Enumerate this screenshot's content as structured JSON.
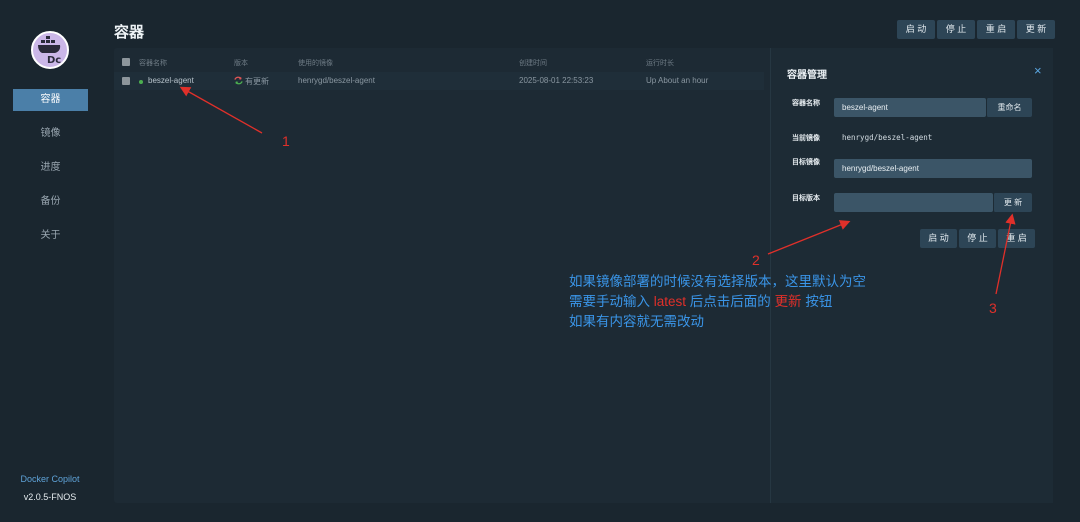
{
  "app": {
    "name": "Docker Copilot",
    "version": "v2.0.5-FNOS"
  },
  "sidebar": {
    "items": [
      {
        "label": "容器",
        "active": true
      },
      {
        "label": "镜像",
        "active": false
      },
      {
        "label": "进度",
        "active": false
      },
      {
        "label": "备份",
        "active": false
      },
      {
        "label": "关于",
        "active": false
      }
    ]
  },
  "header": {
    "title": "容器",
    "buttons": {
      "start": "启 动",
      "stop": "停 止",
      "restart": "重 启",
      "update": "更 新"
    }
  },
  "table": {
    "columns": [
      "容器名称",
      "版本",
      "使用的镜像",
      "创建时间",
      "运行时长"
    ],
    "rows": [
      {
        "name": "beszel-agent",
        "status": "running",
        "version": "有更新",
        "image": "henrygd/beszel-agent",
        "created": "2025-08-01 22:53:23",
        "uptime": "Up About an hour"
      }
    ]
  },
  "drawer": {
    "title": "容器管理",
    "close_icon": "×",
    "container_name_label": "容器名称",
    "container_name_value": "beszel-agent",
    "rename_button": "重命名",
    "current_image_label": "当前镜像",
    "current_image_value": "henrygd/beszel-agent",
    "target_image_label": "目标镜像",
    "target_image_value": "henrygd/beszel-agent",
    "target_version_label": "目标版本",
    "target_version_value": "",
    "update_button": "更 新",
    "actions": {
      "start": "启 动",
      "stop": "停 止",
      "restart": "重 启"
    }
  },
  "annotations": {
    "n1": "1",
    "n2": "2",
    "n3": "3",
    "line1": "如果镜像部署的时候没有选择版本，这里默认为空",
    "line2_a": "需要手动输入 ",
    "line2_b": "latest",
    "line2_c": " 后点击后面的 ",
    "line2_d": "更新",
    "line2_e": " 按钮",
    "line3": "如果有内容就无需改动"
  },
  "colors": {
    "accent": "#4b7fa8",
    "annotation_red": "#e0302a",
    "annotation_blue": "#3a95e8",
    "running": "#4caf50"
  }
}
